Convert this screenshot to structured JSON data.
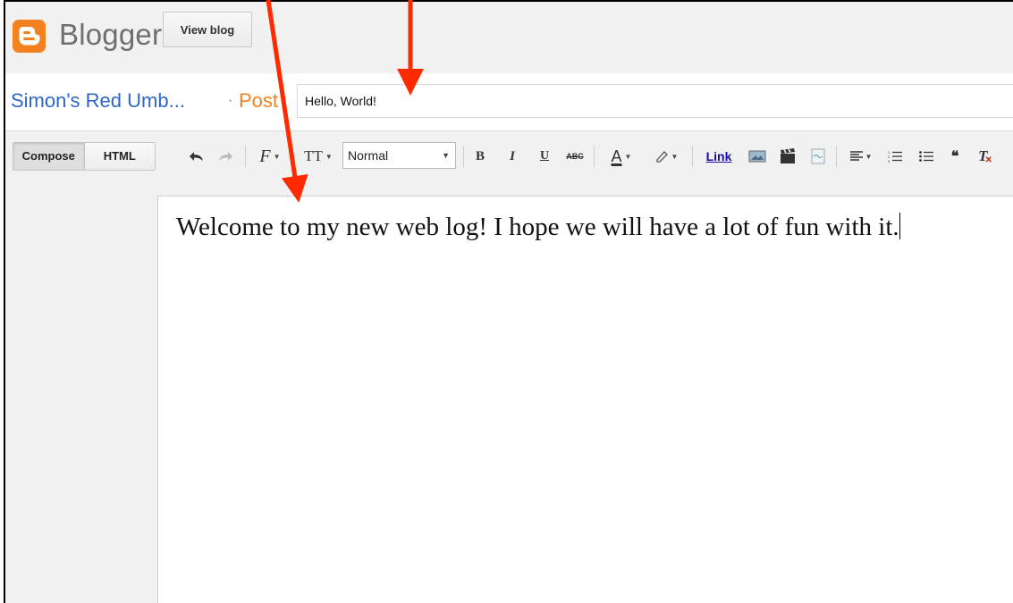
{
  "app": {
    "brand": "Blogger",
    "view_blog_label": "View blog",
    "accent": "#f48120"
  },
  "post": {
    "blog_name": "Simon's Red Umb...",
    "separator": "·",
    "section": "Post",
    "title_value": "Hello, World!"
  },
  "toolbar": {
    "modes": [
      "Compose",
      "HTML"
    ],
    "active_mode": "Compose",
    "font_icon": "F",
    "size_icon": "TT",
    "format_value": "Normal",
    "bold": "B",
    "italic": "I",
    "underline": "U",
    "strike": "ABC",
    "text_color": "A",
    "link_label": "Link",
    "quote": "❝",
    "clear_format": "T"
  },
  "editor": {
    "content": "Welcome to my new web log!  I hope we will have a lot of fun with it."
  },
  "annotations": {
    "arrow_color": "#ff2a00"
  }
}
